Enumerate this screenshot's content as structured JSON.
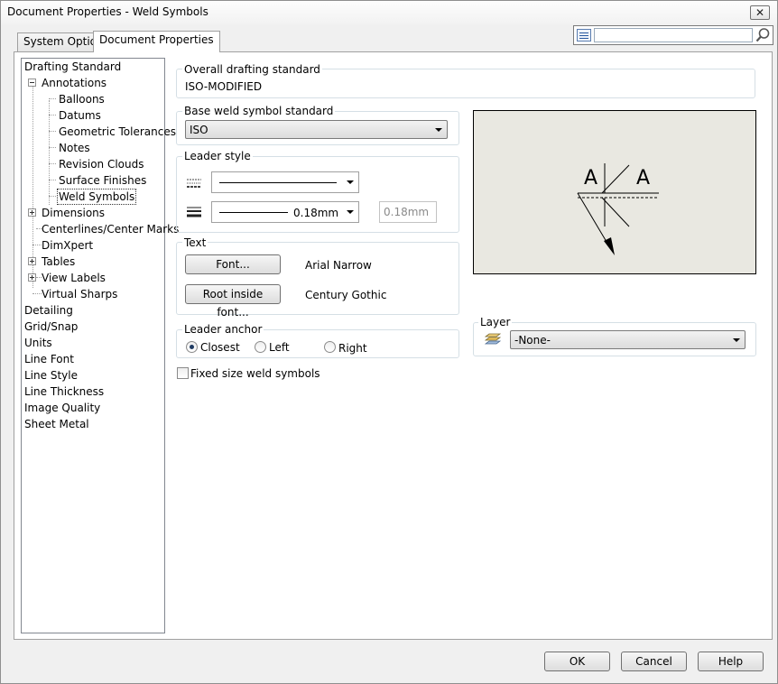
{
  "window": {
    "title": "Document Properties - Weld Symbols",
    "close_glyph": "✕"
  },
  "tabs": [
    {
      "label": "System Options"
    },
    {
      "label": "Document Properties"
    }
  ],
  "search": {
    "placeholder": ""
  },
  "tree": {
    "items": [
      {
        "label": "Drafting Standard"
      },
      {
        "label": "Annotations"
      },
      {
        "label": "Balloons"
      },
      {
        "label": "Datums"
      },
      {
        "label": "Geometric Tolerances"
      },
      {
        "label": "Notes"
      },
      {
        "label": "Revision Clouds"
      },
      {
        "label": "Surface Finishes"
      },
      {
        "label": "Weld Symbols"
      },
      {
        "label": "Dimensions"
      },
      {
        "label": "Centerlines/Center Marks"
      },
      {
        "label": "DimXpert"
      },
      {
        "label": "Tables"
      },
      {
        "label": "View Labels"
      },
      {
        "label": "Virtual Sharps"
      },
      {
        "label": "Detailing"
      },
      {
        "label": "Grid/Snap"
      },
      {
        "label": "Units"
      },
      {
        "label": "Line Font"
      },
      {
        "label": "Line Style"
      },
      {
        "label": "Line Thickness"
      },
      {
        "label": "Image Quality"
      },
      {
        "label": "Sheet Metal"
      }
    ]
  },
  "overall": {
    "label": "Overall drafting standard",
    "value": "ISO-MODIFIED"
  },
  "base_weld": {
    "label": "Base weld symbol standard",
    "value": "ISO"
  },
  "leader_style": {
    "label": "Leader style",
    "thickness_value": "0.18mm",
    "custom_thickness": "0.18mm"
  },
  "text_group": {
    "label": "Text",
    "font_button": "Font...",
    "font_value": "Arial Narrow",
    "root_font_button": "Root inside font...",
    "root_font_value": "Century Gothic"
  },
  "leader_anchor": {
    "label": "Leader anchor",
    "options": [
      {
        "label": "Closest",
        "checked": true
      },
      {
        "label": "Left",
        "checked": false
      },
      {
        "label": "Right",
        "checked": false
      }
    ]
  },
  "fixed_size": {
    "label": "Fixed size weld symbols",
    "checked": false
  },
  "layer": {
    "label": "Layer",
    "value": "-None-"
  },
  "preview": {
    "letter_left": "A",
    "letter_right": "A"
  },
  "footer": {
    "ok": "OK",
    "cancel": "Cancel",
    "help": "Help"
  }
}
